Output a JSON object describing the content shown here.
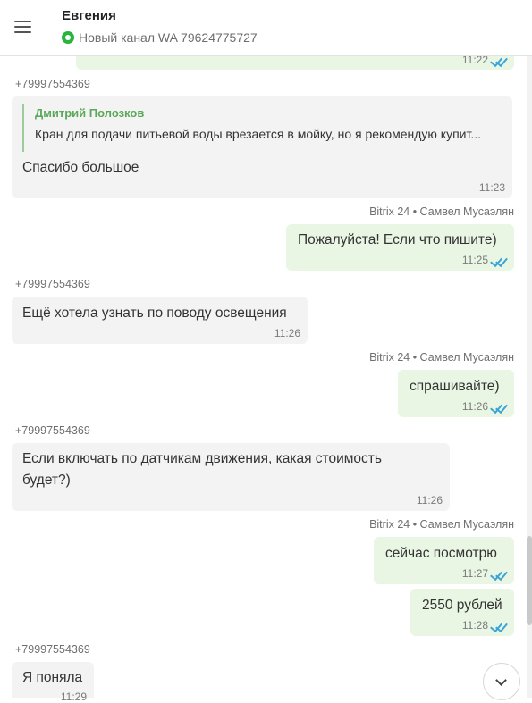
{
  "header": {
    "contact_name": "Евгения",
    "channel": "Новый канал WA 79624775727"
  },
  "messages": [
    {
      "type": "outgoing",
      "time": "11:22",
      "read": true
    },
    {
      "type": "incoming",
      "sender": "+79997554369",
      "quote_author": "Дмитрий Полозков",
      "quote_text": "Кран для подачи питьевой воды врезается в мойку, но я рекомендую купит...",
      "text": "Спасибо большое",
      "time": "11:23"
    },
    {
      "type": "outgoing",
      "sender": "Bitrix 24 • Самвел Мусаэлян",
      "text": "Пожалуйста! Если что пишите)",
      "time": "11:25",
      "read": true
    },
    {
      "type": "incoming",
      "sender": "+79997554369",
      "text": "Ещё хотела узнать по поводу освещения",
      "time": "11:26"
    },
    {
      "type": "outgoing",
      "sender": "Bitrix 24 • Самвел Мусаэлян",
      "text": "спрашивайте)",
      "time": "11:26",
      "read": true
    },
    {
      "type": "incoming",
      "sender": "+79997554369",
      "text_line1": "Если включать по датчикам движения, какая стоимость",
      "text_line2": "будет?)",
      "time": "11:26"
    },
    {
      "type": "outgoing",
      "sender": "Bitrix 24 • Самвел Мусаэлян",
      "text": "сейчас посмотрю",
      "time": "11:27",
      "read": true
    },
    {
      "type": "outgoing",
      "text": "2550 рублей",
      "time": "11:28",
      "read": true
    },
    {
      "type": "incoming",
      "sender": "+79997554369",
      "text": "Я поняла",
      "time": "11:29"
    }
  ]
}
